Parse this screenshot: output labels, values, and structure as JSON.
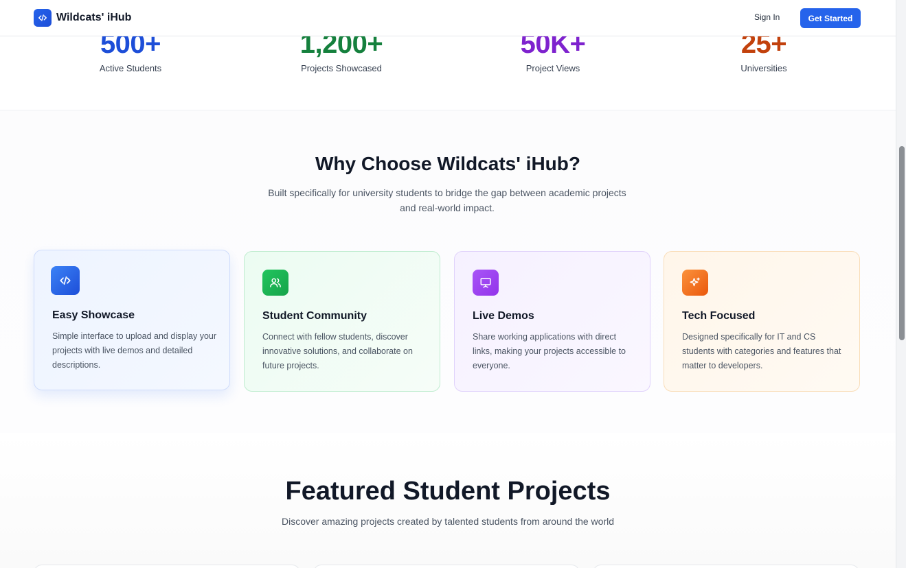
{
  "header": {
    "logo_text": "Wildcats' iHub",
    "signin_label": "Sign In",
    "get_started_label": "Get Started"
  },
  "stats": [
    {
      "value": "500+",
      "label": "Active Students",
      "color": "#1d4ed8"
    },
    {
      "value": "1,200+",
      "label": "Projects Showcased",
      "color": "#15803d"
    },
    {
      "value": "50K+",
      "label": "Project Views",
      "color": "#7e22ce"
    },
    {
      "value": "25+",
      "label": "Universities",
      "color": "#c2410c"
    }
  ],
  "why": {
    "title": "Why Choose Wildcats' iHub?",
    "subtitle": "Built specifically for university students to bridge the gap between academic projects and real-world impact.",
    "cards": [
      {
        "title": "Easy Showcase",
        "description": "Simple interface to upload and display your projects with live demos and detailed descriptions.",
        "icon": "code-icon"
      },
      {
        "title": "Student Community",
        "description": "Connect with fellow students, discover innovative solutions, and collaborate on future projects.",
        "icon": "users-icon"
      },
      {
        "title": "Live Demos",
        "description": "Share working applications with direct links, making your projects accessible to everyone.",
        "icon": "presentation-icon"
      },
      {
        "title": "Tech Focused",
        "description": "Designed specifically for IT and CS students with categories and features that matter to developers.",
        "icon": "sparkles-icon"
      }
    ]
  },
  "featured": {
    "title": "Featured Student Projects",
    "subtitle": "Discover amazing projects created by talented students from around the world"
  }
}
